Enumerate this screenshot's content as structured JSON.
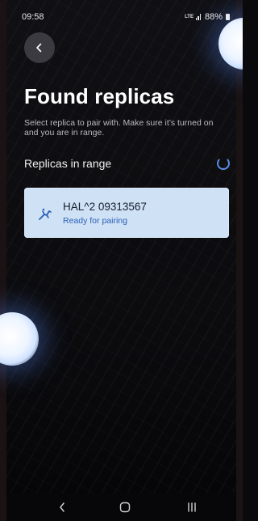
{
  "status_bar": {
    "time": "09:58",
    "network": "LTE",
    "battery": "88%"
  },
  "header": {
    "title": "Found replicas",
    "subtitle": "Select replica to pair with. Make sure it’s turned on and you are in range."
  },
  "section": {
    "label": "Replicas in range"
  },
  "devices": [
    {
      "name": "HAL^2 09313567",
      "status": "Ready for pairing",
      "icon": "replica-icon"
    }
  ],
  "colors": {
    "background": "#0b0b0e",
    "card": "#cfe1f5",
    "accent": "#2a5fb8",
    "back_button": "#3a3a40"
  },
  "nav": {
    "icons": [
      "back-icon",
      "home-icon",
      "recents-icon"
    ]
  }
}
